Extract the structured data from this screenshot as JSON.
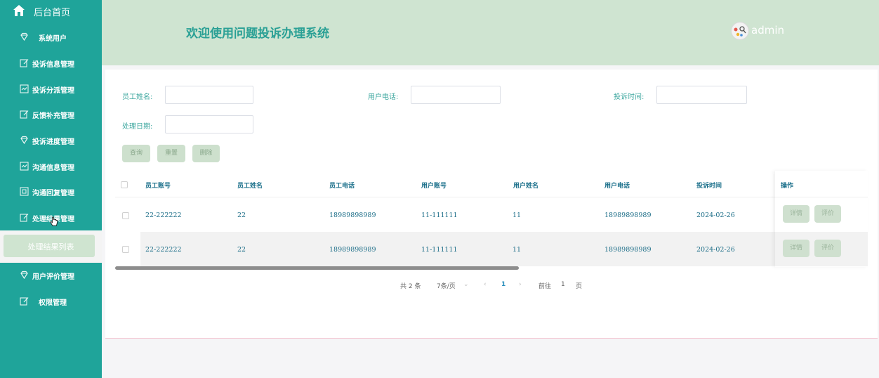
{
  "sidebar": {
    "home_label": "后台首页",
    "items": [
      {
        "label": "系统用户",
        "icon": "diamond-icon"
      },
      {
        "label": "投诉信息管理",
        "icon": "edit-icon"
      },
      {
        "label": "投诉分派管理",
        "icon": "chart-icon"
      },
      {
        "label": "反馈补充管理",
        "icon": "edit-icon"
      },
      {
        "label": "投诉进度管理",
        "icon": "diamond-icon"
      },
      {
        "label": "沟通信息管理",
        "icon": "chart-icon"
      },
      {
        "label": "沟通回复管理",
        "icon": "image-icon"
      },
      {
        "label": "处理结果管理",
        "icon": "edit-icon"
      },
      {
        "label": "用户评价管理",
        "icon": "diamond-icon"
      },
      {
        "label": "权限管理",
        "icon": "edit-icon"
      }
    ],
    "submenu_label": "处理结果列表"
  },
  "header": {
    "title": "欢迎使用问题投诉办理系统",
    "username": "admin"
  },
  "filters": {
    "employee_name_label": "员工姓名:",
    "user_phone_label": "用户电话:",
    "complaint_time_label": "投诉时间:",
    "process_date_label": "处理日期:",
    "query_btn": "查询",
    "reset_btn": "重置",
    "delete_btn": "删除"
  },
  "table": {
    "columns": [
      "员工账号",
      "员工姓名",
      "员工电话",
      "用户账号",
      "用户姓名",
      "用户电话",
      "投诉时间",
      "操作"
    ],
    "rows": [
      {
        "emp_account": "22-222222",
        "emp_name": "22",
        "emp_phone": "18989898989",
        "user_account": "11-111111",
        "user_name": "11",
        "user_phone": "18989898989",
        "time": "2024-02-26"
      },
      {
        "emp_account": "22-222222",
        "emp_name": "22",
        "emp_phone": "18989898989",
        "user_account": "11-111111",
        "user_name": "11",
        "user_phone": "18989898989",
        "time": "2024-02-26"
      }
    ],
    "detail_btn": "详情",
    "review_btn": "评价"
  },
  "pagination": {
    "total": "共 2 条",
    "page_size": "7条/页",
    "current_page": "1",
    "goto_label": "前往",
    "goto_value": "1",
    "page_unit": "页"
  },
  "colors": {
    "sidebar": "#1fa49a",
    "header": "#cfe4d1",
    "title": "#2aa095",
    "button": "#cde0cd"
  }
}
